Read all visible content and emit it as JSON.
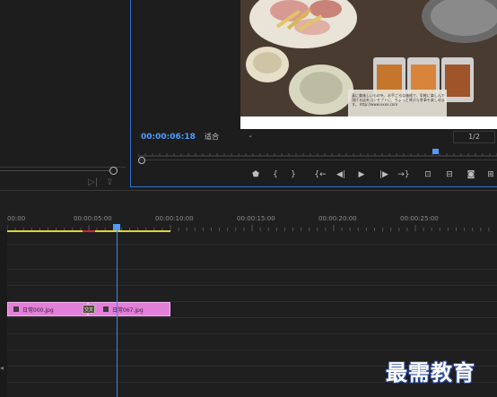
{
  "monitor": {
    "timecode": "00:00:06:18",
    "fit_label": "适合",
    "resolution": "1/2",
    "video_caption": "真に美味しいものを、お手ごろな価格で、気軽に楽しんで頂ける店をコンセプトに、ちょっと贅沢な食事を楽しめます。 http://www.xxxx.com"
  },
  "controls": [
    "add-marker-icon",
    "mark-in-icon",
    "mark-out-icon",
    "go-to-in-icon",
    "step-back-icon",
    "play-icon",
    "step-forward-icon",
    "go-to-out-icon",
    "lift-icon",
    "extract-icon",
    "export-frame-icon",
    "button-editor-icon"
  ],
  "control_glyphs": [
    "⬟",
    "{",
    "}",
    "{←",
    "◀|",
    "▶",
    "|▶",
    "→}",
    "⊡",
    "⊟",
    "◙",
    "⊞"
  ],
  "timeline": {
    "ruler": [
      "00:00",
      "00:00:05:00",
      "00:00:10:00",
      "00:00:15:00",
      "00:00:20:00",
      "00:00:25:00"
    ],
    "clips": [
      {
        "label": "日常000.jpg"
      },
      {
        "label": "日常067.jpg"
      }
    ],
    "transition_label": "交叉",
    "playhead_time": "00:00:06:18"
  },
  "watermark": "最需教育",
  "colors": {
    "accent": "#4f9cff",
    "clip": "#e27fd9",
    "work_area": "#e2d33a"
  }
}
